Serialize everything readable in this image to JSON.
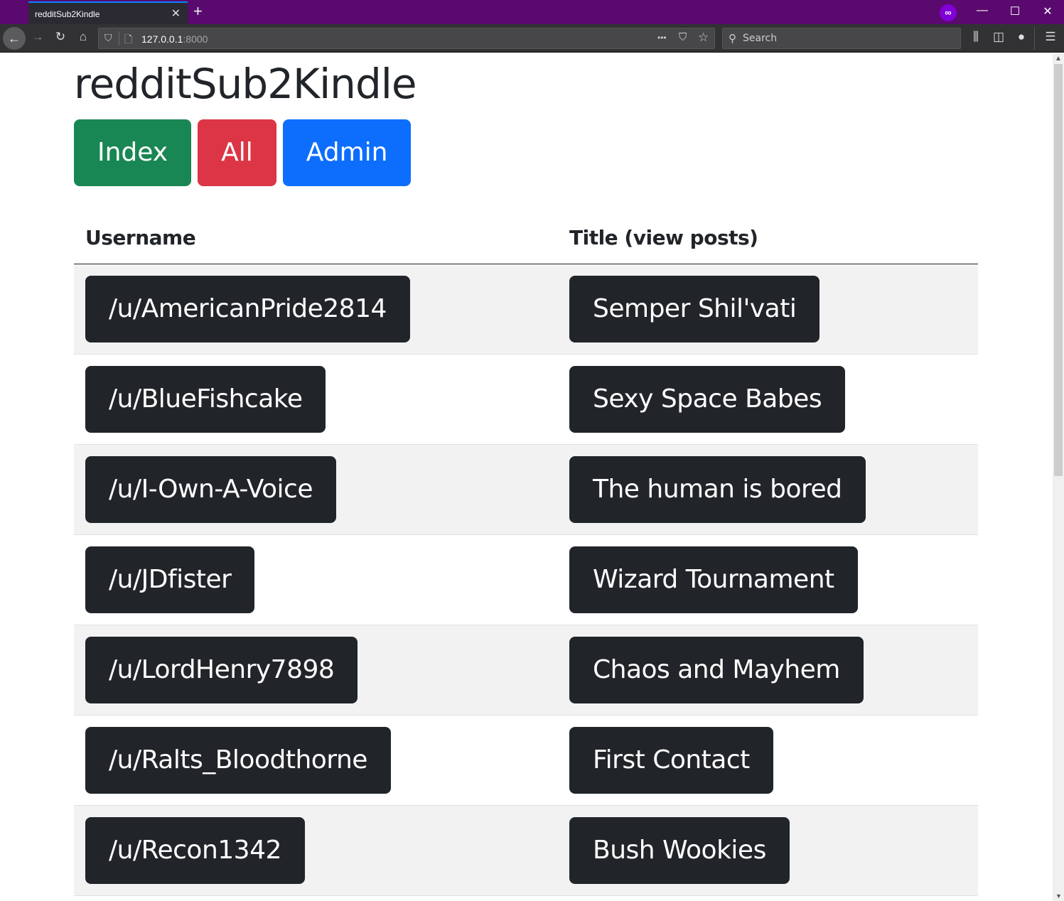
{
  "browser": {
    "tab_title": "redditSub2Kindle",
    "tab_close": "✕",
    "new_tab": "+",
    "url_host": "127.0.0.1",
    "url_port": ":8000",
    "search_placeholder": "Search",
    "icons": {
      "back": "←",
      "forward": "→",
      "reload": "↻",
      "home": "⌂",
      "shield": "⛉",
      "page": "🗋",
      "more": "•••",
      "pocket": "⛉",
      "star": "☆",
      "search": "⚲",
      "library": "⫼",
      "sidebar": "◫",
      "account": "●",
      "menu": "☰",
      "private": "∞",
      "minimize": "—",
      "maximize": "☐",
      "close": "✕",
      "scroll_up": "▲",
      "scroll_down": "▼"
    }
  },
  "page": {
    "title": "redditSub2Kindle",
    "nav_buttons": [
      {
        "label": "Index",
        "color": "#198754"
      },
      {
        "label": "All",
        "color": "#dc3545"
      },
      {
        "label": "Admin",
        "color": "#0d6efd"
      }
    ],
    "table": {
      "headers": [
        "Username",
        "Title (view posts)"
      ],
      "rows": [
        {
          "username": "/u/AmericanPride2814",
          "title": "Semper Shil'vati"
        },
        {
          "username": "/u/BlueFishcake",
          "title": "Sexy Space Babes"
        },
        {
          "username": "/u/I-Own-A-Voice",
          "title": "The human is bored"
        },
        {
          "username": "/u/JDfister",
          "title": "Wizard Tournament"
        },
        {
          "username": "/u/LordHenry7898",
          "title": "Chaos and Mayhem"
        },
        {
          "username": "/u/Ralts_Bloodthorne",
          "title": "First Contact"
        },
        {
          "username": "/u/Recon1342",
          "title": "Bush Wookies"
        }
      ]
    }
  }
}
